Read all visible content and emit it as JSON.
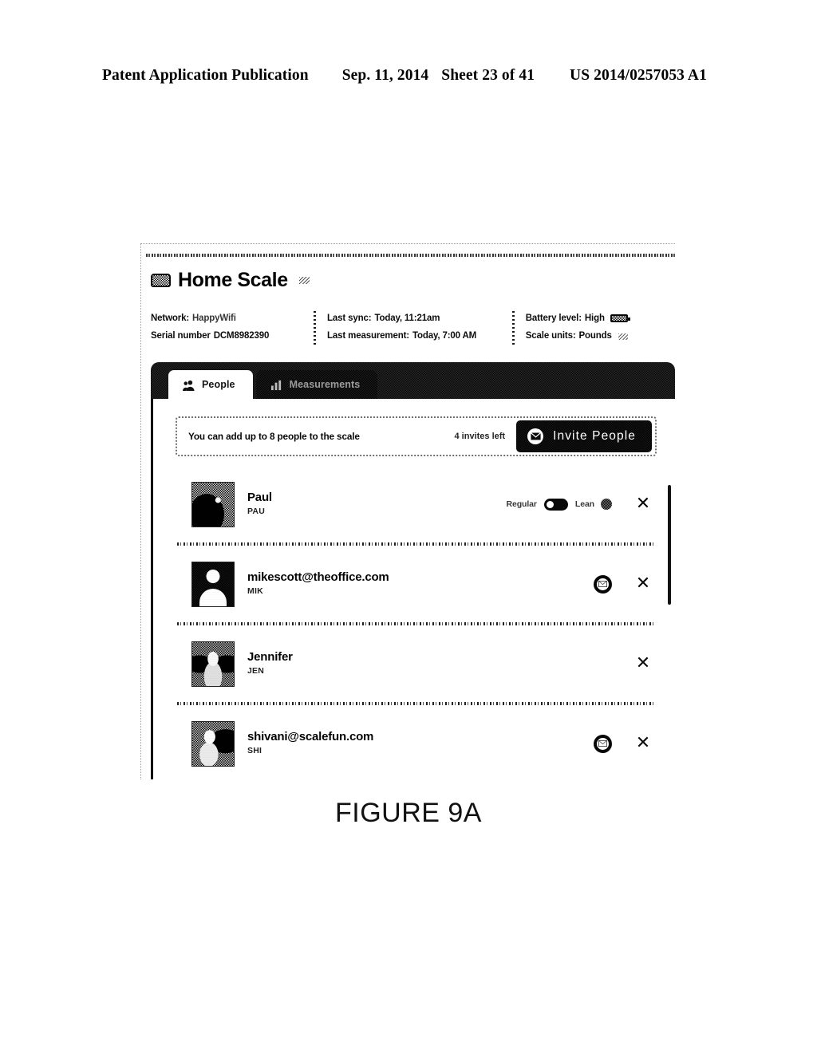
{
  "patent_header": {
    "publication": "Patent Application Publication",
    "date": "Sep. 11, 2014",
    "sheet": "Sheet 23 of 41",
    "number": "US 2014/0257053 A1"
  },
  "figure_caption": "FIGURE 9A",
  "device": {
    "name": "Home Scale",
    "scale_icon": "scale-icon",
    "edit_icon": "edit-pencil-icon"
  },
  "meta": {
    "network_label": "Network:",
    "network_value": "HappyWifi",
    "serial_label": "Serial number",
    "serial_value": "DCM8982390",
    "last_sync_label": "Last sync:",
    "last_sync_value": "Today, 11:21am",
    "last_measurement_label": "Last measurement:",
    "last_measurement_value": "Today, 7:00 AM",
    "battery_label": "Battery level:",
    "battery_value": "High",
    "battery_icon": "battery-full-icon",
    "units_label": "Scale units:",
    "units_value": "Pounds",
    "units_edit_icon": "edit-pencil-icon"
  },
  "tabs": [
    {
      "label": "People",
      "icon": "people-icon",
      "active": true
    },
    {
      "label": "Measurements",
      "icon": "bar-chart-icon",
      "active": false
    }
  ],
  "invite_banner": {
    "text": "You can add up to 8 people to the scale",
    "invites_left": "4 invites left",
    "button_label": "Invite People",
    "button_icon": "envelope-icon"
  },
  "people": [
    {
      "name": "Paul",
      "initials": "PAU",
      "avatar": "user-photo",
      "mode_left_label": "Regular",
      "mode_right_label": "Lean",
      "toggle_state": "off",
      "info_icon": "info-dot-icon",
      "remove_icon": "close-icon",
      "pending": false
    },
    {
      "name": "mikescott@theoffice.com",
      "initials": "MIK",
      "avatar": "user-placeholder",
      "pending": true,
      "pending_icon": "envelope-pending-icon",
      "remove_icon": "close-icon"
    },
    {
      "name": "Jennifer",
      "initials": "JEN",
      "avatar": "user-photo",
      "pending": false,
      "remove_icon": "close-icon"
    },
    {
      "name": "shivani@scalefun.com",
      "initials": "SHI",
      "avatar": "user-photo",
      "pending": true,
      "pending_icon": "envelope-pending-icon",
      "remove_icon": "close-icon"
    }
  ],
  "colors": {
    "ink": "#0d0d0d",
    "tabbar_dark": "#1d1d1d",
    "button_dark": "#0d0d0d",
    "paper": "#ffffff"
  }
}
